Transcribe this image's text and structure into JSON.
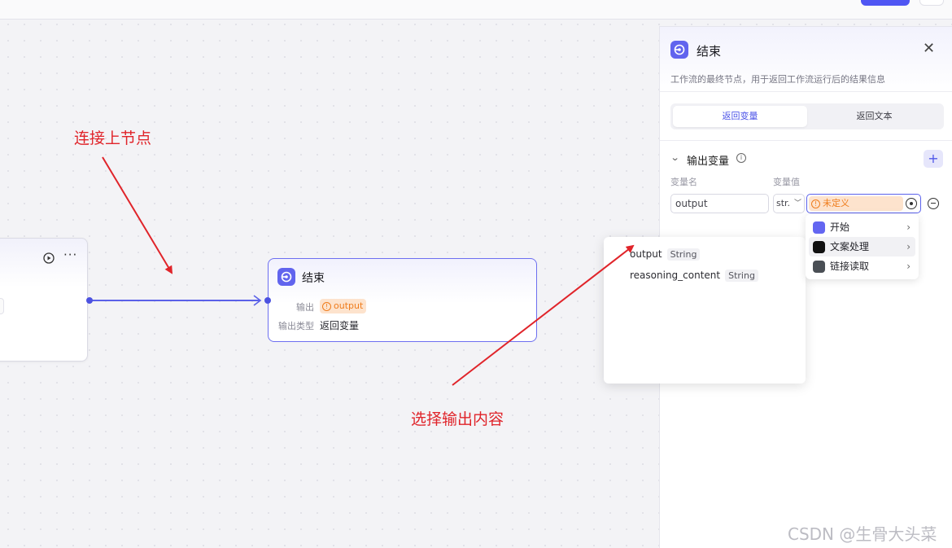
{
  "canvas": {
    "annotations": {
      "connect": "连接上节点",
      "select_output": "选择输出内容"
    },
    "end_node": {
      "title": "结束",
      "output_label": "输出",
      "output_value": "output",
      "output_type_label": "输出类型",
      "output_type_value": "返回变量"
    }
  },
  "panel": {
    "title": "结束",
    "description": "工作流的最终节点，用于返回工作流运行后的结果信息",
    "tabs": [
      {
        "label": "返回变量",
        "active": true
      },
      {
        "label": "返回文本",
        "active": false
      }
    ],
    "section_title": "输出变量",
    "col_name": "变量名",
    "col_value": "变量值",
    "var_name": "output",
    "var_type": "str.",
    "var_value_placeholder": "未定义"
  },
  "dropdown": {
    "items": [
      {
        "label": "开始",
        "icon": "start-node-icon",
        "color": "#6366f1"
      },
      {
        "label": "文案处理",
        "icon": "ai-model-icon",
        "color": "#111111"
      },
      {
        "label": "链接读取",
        "icon": "link-reader-icon",
        "color": "#4a4f55"
      }
    ]
  },
  "popover": {
    "variables": [
      {
        "name": "output",
        "type": "String"
      },
      {
        "name": "reasoning_content",
        "type": "String"
      }
    ]
  },
  "watermark": "CSDN @生骨大头菜",
  "colors": {
    "accent": "#5057e8",
    "annotation": "#e0242a",
    "warning": "#ef7c1c"
  }
}
